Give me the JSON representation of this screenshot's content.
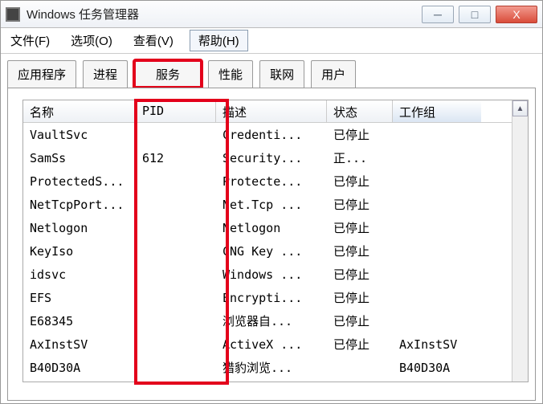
{
  "window": {
    "title": "Windows 任务管理器",
    "controls": {
      "minimize": "─",
      "maximize": "□",
      "close": "X"
    }
  },
  "menubar": {
    "file": "文件(F)",
    "options": "选项(O)",
    "view": "查看(V)",
    "help": "帮助(H)"
  },
  "tabs": {
    "applications": "应用程序",
    "processes": "进程",
    "services": "服务",
    "performance": "性能",
    "networking": "联网",
    "users": "用户"
  },
  "columns": {
    "name": "名称",
    "pid": "PID",
    "description": "描述",
    "state": "状态",
    "group": "工作组"
  },
  "rows": [
    {
      "name": "VaultSvc",
      "pid": "",
      "desc": "Credenti...",
      "state": "已停止",
      "group": ""
    },
    {
      "name": "SamSs",
      "pid": "612",
      "desc": "Security...",
      "state": "正...",
      "group": ""
    },
    {
      "name": "ProtectedS...",
      "pid": "",
      "desc": "Protecte...",
      "state": "已停止",
      "group": ""
    },
    {
      "name": "NetTcpPort...",
      "pid": "",
      "desc": "Net.Tcp ...",
      "state": "已停止",
      "group": ""
    },
    {
      "name": "Netlogon",
      "pid": "",
      "desc": "Netlogon",
      "state": "已停止",
      "group": ""
    },
    {
      "name": "KeyIso",
      "pid": "",
      "desc": "CNG Key ...",
      "state": "已停止",
      "group": ""
    },
    {
      "name": "idsvc",
      "pid": "",
      "desc": "Windows ...",
      "state": "已停止",
      "group": ""
    },
    {
      "name": "EFS",
      "pid": "",
      "desc": "Encrypti...",
      "state": "已停止",
      "group": ""
    },
    {
      "name": "E68345",
      "pid": "",
      "desc": "浏览器自...",
      "state": "已停止",
      "group": ""
    },
    {
      "name": "AxInstSV",
      "pid": "",
      "desc": "ActiveX ...",
      "state": "已停止",
      "group": "AxInstSV"
    },
    {
      "name": "B40D30A",
      "pid": "",
      "desc": "猎豹浏览...",
      "state": "",
      "group": "B40D30A"
    }
  ],
  "scroll": {
    "up": "▲",
    "down": "▼"
  }
}
